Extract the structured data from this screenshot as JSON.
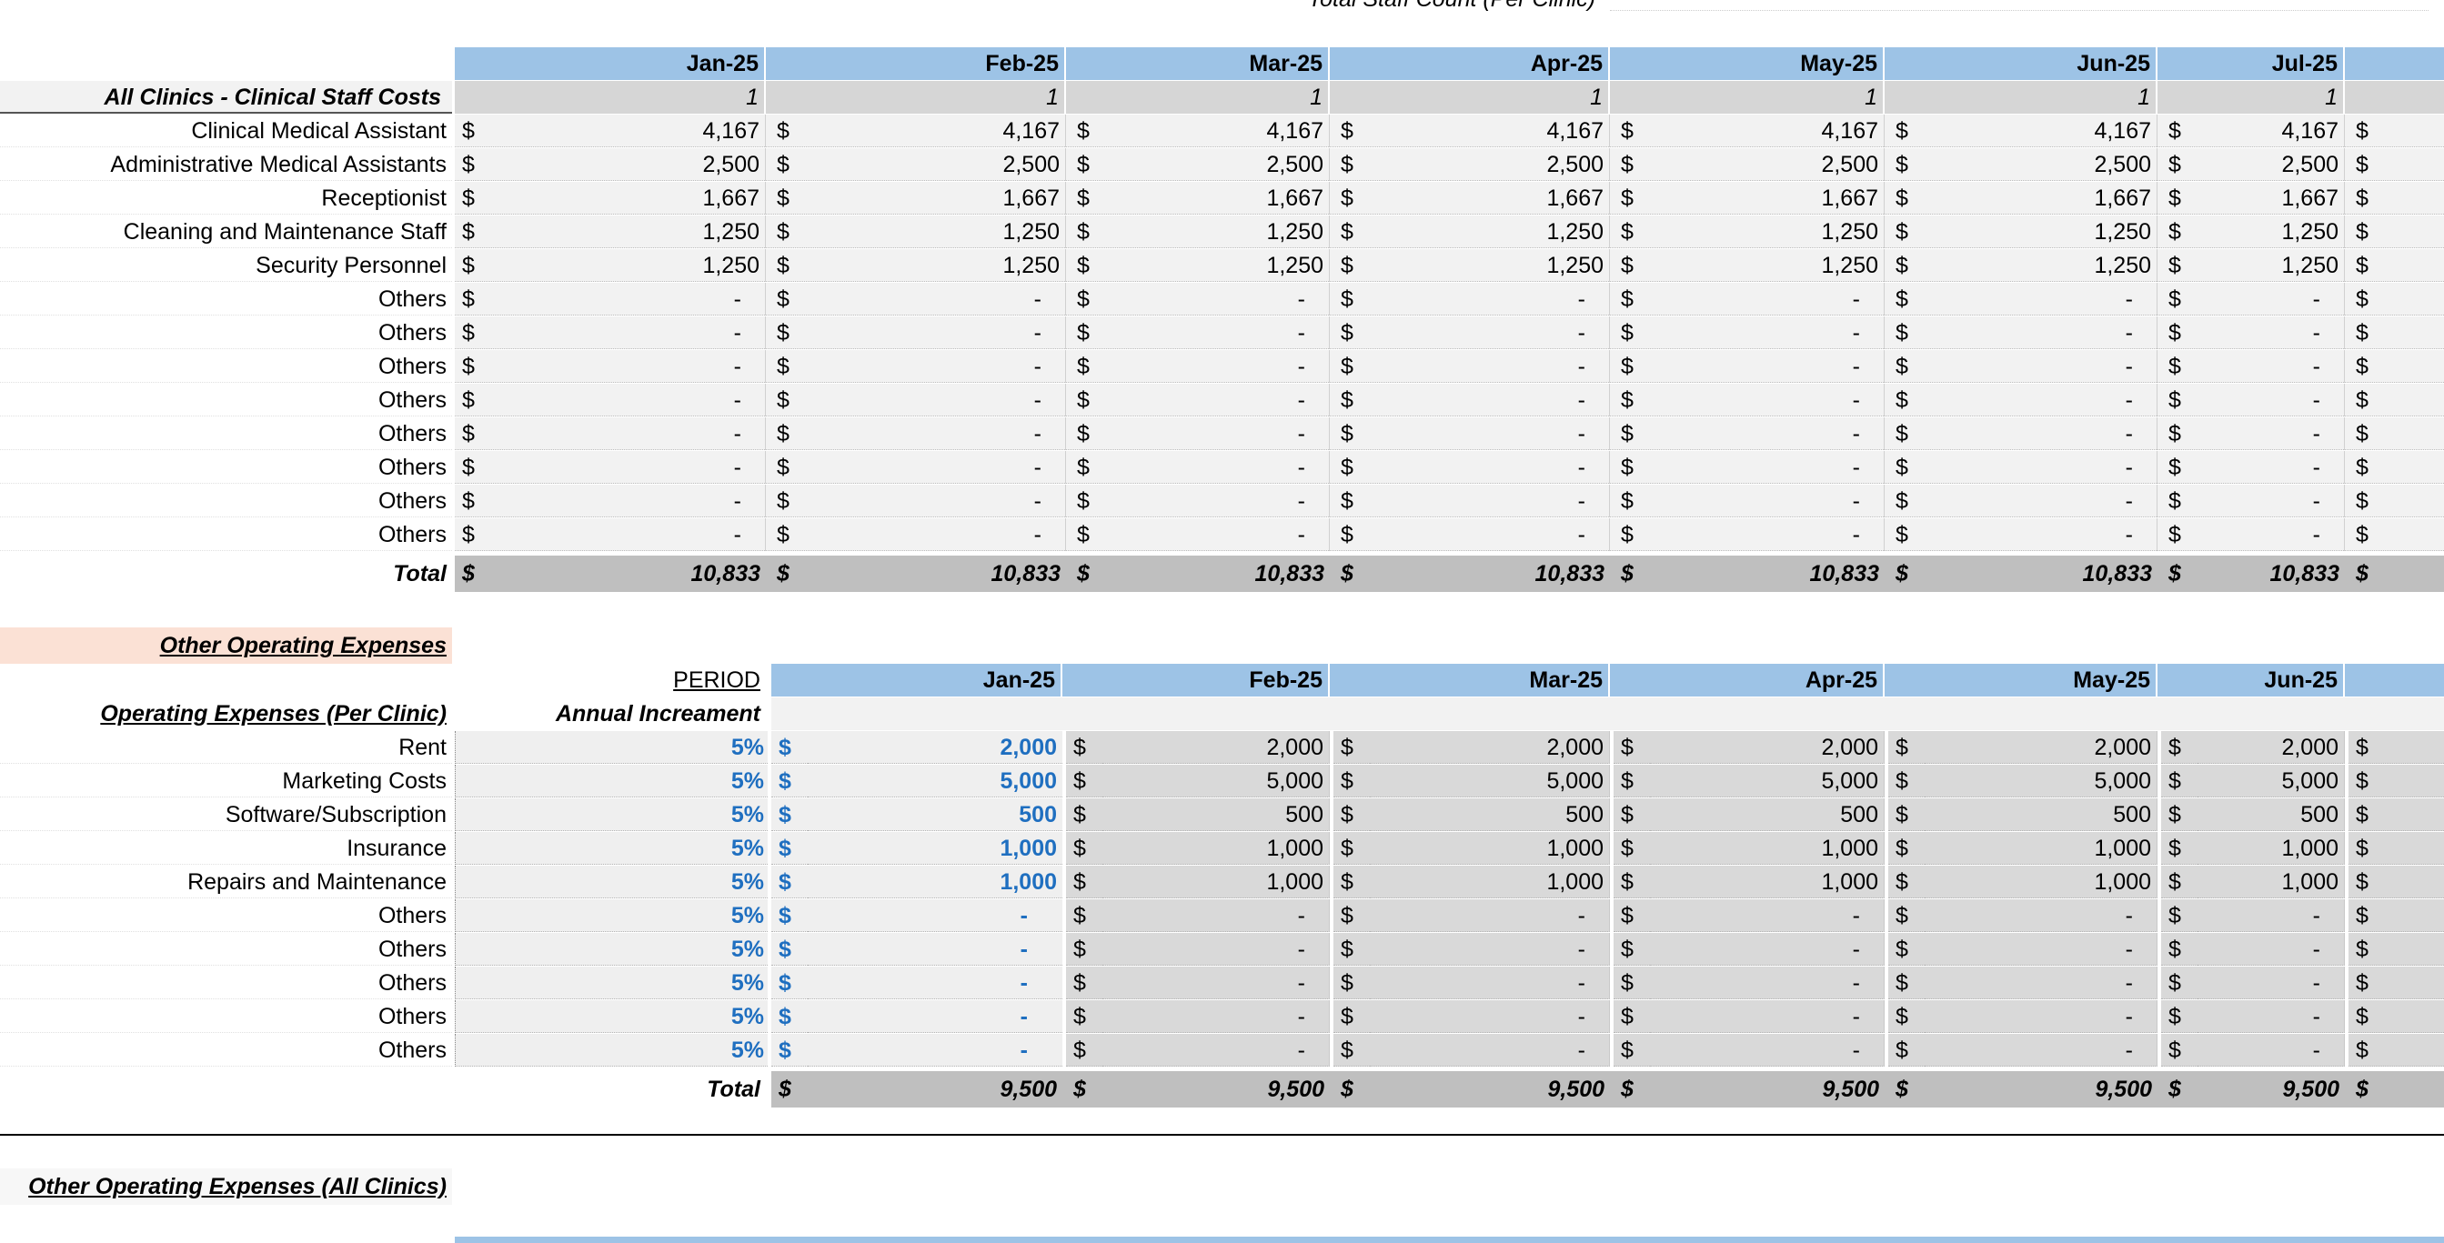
{
  "top_label": "Total Staff Count (Per Clinic)",
  "staff_section": {
    "title": "All Clinics - Clinical Staff Costs",
    "months": [
      "Jan-25",
      "Feb-25",
      "Mar-25",
      "Apr-25",
      "May-25",
      "Jun-25",
      "Jul-25"
    ],
    "counts": [
      "1",
      "1",
      "1",
      "1",
      "1",
      "1",
      "1"
    ],
    "rows": [
      {
        "label": "Clinical Medical Assistant",
        "value": "4,167"
      },
      {
        "label": "Administrative Medical Assistants",
        "value": "2,500"
      },
      {
        "label": "Receptionist",
        "value": "1,667"
      },
      {
        "label": "Cleaning and Maintenance Staff",
        "value": "1,250"
      },
      {
        "label": "Security Personnel",
        "value": "1,250"
      },
      {
        "label": "Others",
        "value": "-"
      },
      {
        "label": "Others",
        "value": "-"
      },
      {
        "label": "Others",
        "value": "-"
      },
      {
        "label": "Others",
        "value": "-"
      },
      {
        "label": "Others",
        "value": "-"
      },
      {
        "label": "Others",
        "value": "-"
      },
      {
        "label": "Others",
        "value": "-"
      },
      {
        "label": "Others",
        "value": "-"
      }
    ],
    "total_label": "Total",
    "total_value": "10,833"
  },
  "opex_title": "Other Operating Expenses",
  "opex_section": {
    "period_label": "PERIOD",
    "title": "Operating Expenses (Per Clinic)",
    "increment_label": "Annual Increament",
    "months": [
      "Jan-25",
      "Feb-25",
      "Mar-25",
      "Apr-25",
      "May-25",
      "Jun-25"
    ],
    "rows": [
      {
        "label": "Rent",
        "rate": "5%",
        "input": "2,000",
        "value": "2,000"
      },
      {
        "label": "Marketing Costs",
        "rate": "5%",
        "input": "5,000",
        "value": "5,000"
      },
      {
        "label": "Software/Subscription",
        "rate": "5%",
        "input": "500",
        "value": "500"
      },
      {
        "label": "Insurance",
        "rate": "5%",
        "input": "1,000",
        "value": "1,000"
      },
      {
        "label": "Repairs and Maintenance",
        "rate": "5%",
        "input": "1,000",
        "value": "1,000"
      },
      {
        "label": "Others",
        "rate": "5%",
        "input": "-",
        "value": "-"
      },
      {
        "label": "Others",
        "rate": "5%",
        "input": "-",
        "value": "-"
      },
      {
        "label": "Others",
        "rate": "5%",
        "input": "-",
        "value": "-"
      },
      {
        "label": "Others",
        "rate": "5%",
        "input": "-",
        "value": "-"
      },
      {
        "label": "Others",
        "rate": "5%",
        "input": "-",
        "value": "-"
      }
    ],
    "total_label": "Total",
    "total_value": "9,500"
  },
  "all_clinics_title": "Other Operating Expenses (All Clinics)",
  "currency": "$",
  "colors": {
    "header_blue": "#9dc3e6",
    "input_blue": "#1f6fc0",
    "total_gray": "#bfbfbf",
    "row_gray": "#f2f2f2",
    "section_highlight": "#fbe1d5"
  }
}
